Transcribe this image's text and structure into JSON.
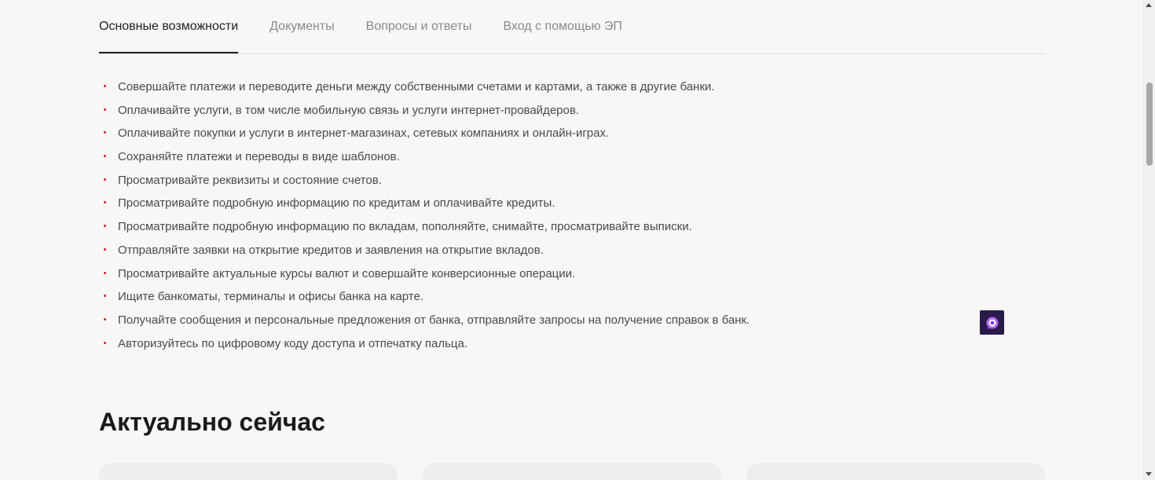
{
  "tabs": [
    {
      "label": "Основные возможности",
      "active": true
    },
    {
      "label": "Документы",
      "active": false
    },
    {
      "label": "Вопросы и ответы",
      "active": false
    },
    {
      "label": "Вход с помощью ЭП",
      "active": false
    }
  ],
  "features": [
    "Совершайте платежи и переводите деньги между собственными счетами и картами, а также в другие банки.",
    "Оплачивайте услуги, в том числе мобильную связь и услуги интернет-провайдеров.",
    "Оплачивайте покупки и услуги в интернет-магазинах, сетевых компаниях и онлайн-играх.",
    "Сохраняйте платежи и переводы в виде шаблонов.",
    "Просматривайте реквизиты и состояние счетов.",
    "Просматривайте подробную информацию по кредитам и оплачивайте кредиты.",
    "Просматривайте подробную информацию по вкладам, пополняйте, снимайте, просматривайте выписки.",
    "Отправляйте заявки на открытие кредитов и заявления на открытие вкладов.",
    "Просматривайте актуальные курсы валют и совершайте конверсионные операции.",
    "Ищите банкоматы, терминалы и офисы банка на карте.",
    "Получайте сообщения и персональные предложения от банка, отправляйте запросы на получение справок в банк.",
    "Авторизуйтесь по цифровому коду доступа и отпечатку пальца."
  ],
  "section": {
    "title": "Актуально сейчас"
  },
  "chat_widget": {
    "icon": "chat-bubble-icon"
  },
  "colors": {
    "background": "#f8f7f5",
    "bullet": "#d0202a",
    "active_tab": "#1f1f1f",
    "inactive_tab": "#8a8a8a",
    "chat_widget_bg": "#2a1a4a",
    "chat_widget_accent": "#b06cff"
  }
}
